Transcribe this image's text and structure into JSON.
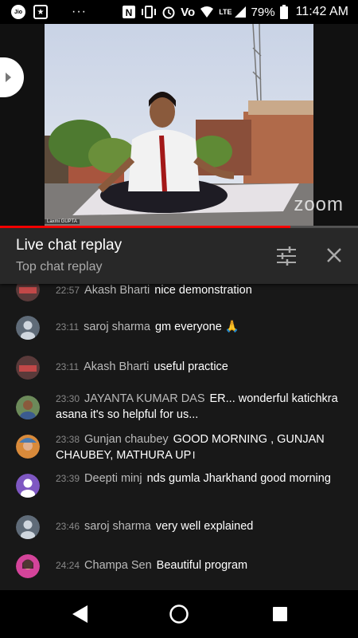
{
  "status_bar": {
    "carrier_icon": "jio-icon",
    "app_icon": "youtube-star-icon",
    "more": "···",
    "nfc_icon": "nfc-icon",
    "vibrate_icon": "vibrate-icon",
    "alarm_icon": "alarm-icon",
    "volte": "Vo",
    "network": "LTE",
    "battery": "79%",
    "time": "11:42 AM"
  },
  "video": {
    "watermark": "zoom",
    "name_tag": "Laxmi GUPTA",
    "progress": 0.81
  },
  "chat": {
    "title": "Live chat replay",
    "subtitle": "Top chat replay",
    "messages": [
      {
        "time": "22:57",
        "author": "Akash Bharti",
        "text": "nice demonstration",
        "avatar": "photo"
      },
      {
        "time": "23:11",
        "author": "saroj sharma",
        "text": "gm everyone 🙏",
        "avatar": "default"
      },
      {
        "time": "23:11",
        "author": "Akash Bharti",
        "text": "useful practice",
        "avatar": "photo"
      },
      {
        "time": "23:30",
        "author": "JAYANTA KUMAR DAS",
        "text": "ER... wonderful katichkra asana it's so helpful for us...",
        "avatar": "photo-jayanta"
      },
      {
        "time": "23:38",
        "author": "Gunjan chaubey",
        "text": "GOOD MORNING , GUNJAN CHAUBEY, MATHURA UP।",
        "avatar": "photo-gunjan"
      },
      {
        "time": "23:39",
        "author": "Deepti minj",
        "text": "nds gumla Jharkhand good morning",
        "avatar": "purple-default"
      },
      {
        "time": "23:46",
        "author": "saroj sharma",
        "text": "very well explained",
        "avatar": "default"
      },
      {
        "time": "24:24",
        "author": "Champa Sen",
        "text": "Beautiful program",
        "avatar": "photo-champa"
      }
    ]
  },
  "nav": {
    "back_icon": "back-icon",
    "home_icon": "home-icon",
    "recents_icon": "recents-icon"
  },
  "colors": {
    "progress": "#ff0000",
    "chat_header_bg": "#282828",
    "chat_bg": "#181818",
    "accent_purple": "#7e57c2"
  }
}
